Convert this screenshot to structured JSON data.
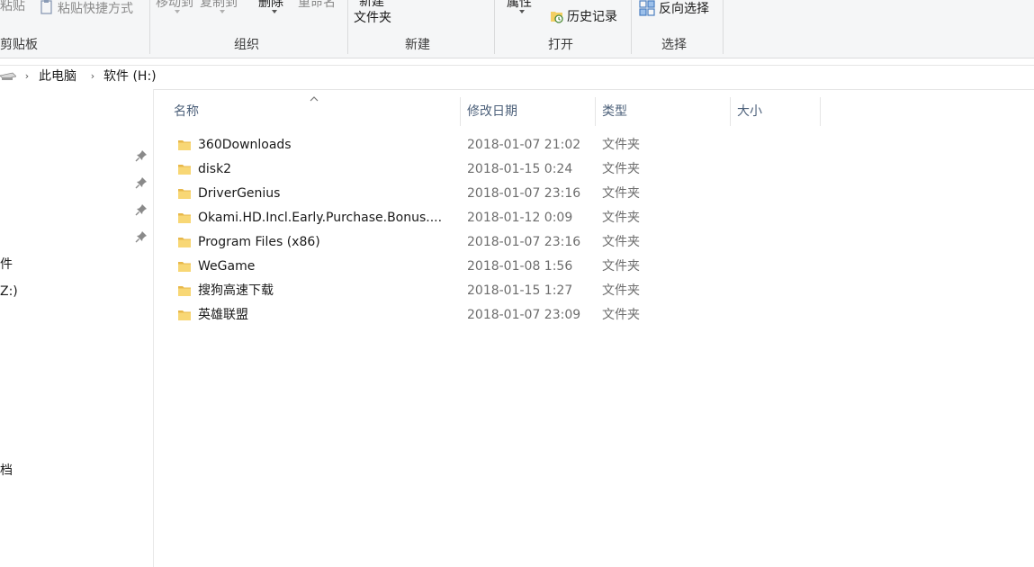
{
  "ribbon": {
    "clipboard": {
      "paste_label": "粘贴",
      "paste_shortcut_label": "粘贴快捷方式",
      "group_label": "剪贴板"
    },
    "organize": {
      "move_to_label": "移动到",
      "copy_to_label": "复制到",
      "delete_label": "删除",
      "rename_label": "重命名",
      "group_label": "组织"
    },
    "new": {
      "new_folder_label_line1": "新建",
      "new_folder_label_line2": "文件夹",
      "group_label": "新建"
    },
    "open": {
      "properties_label": "属性",
      "history_label": "历史记录",
      "group_label": "打开"
    },
    "select": {
      "invert_selection_label": "反向选择",
      "group_label": "选择"
    }
  },
  "address": {
    "crumbs": [
      "此电脑",
      "软件 (H:)"
    ]
  },
  "navpane": {
    "items": [
      {
        "label": "件"
      },
      {
        "label": "Z:)"
      },
      {
        "label": "档"
      }
    ]
  },
  "columns": {
    "name": "名称",
    "date": "修改日期",
    "type": "类型",
    "size": "大小"
  },
  "files": [
    {
      "name": "360Downloads",
      "date": "2018-01-07 21:02",
      "type": "文件夹",
      "size": ""
    },
    {
      "name": "disk2",
      "date": "2018-01-15 0:24",
      "type": "文件夹",
      "size": ""
    },
    {
      "name": "DriverGenius",
      "date": "2018-01-07 23:16",
      "type": "文件夹",
      "size": ""
    },
    {
      "name": "Okami.HD.Incl.Early.Purchase.Bonus....",
      "date": "2018-01-12 0:09",
      "type": "文件夹",
      "size": ""
    },
    {
      "name": "Program Files (x86)",
      "date": "2018-01-07 23:16",
      "type": "文件夹",
      "size": ""
    },
    {
      "name": "WeGame",
      "date": "2018-01-08 1:56",
      "type": "文件夹",
      "size": ""
    },
    {
      "name": "搜狗高速下载",
      "date": "2018-01-15 1:27",
      "type": "文件夹",
      "size": ""
    },
    {
      "name": "英雄联盟",
      "date": "2018-01-07 23:09",
      "type": "文件夹",
      "size": ""
    }
  ],
  "colors": {
    "folder_body": "#f8d775",
    "folder_tab": "#e8b84a",
    "header_text": "#4c607a"
  }
}
